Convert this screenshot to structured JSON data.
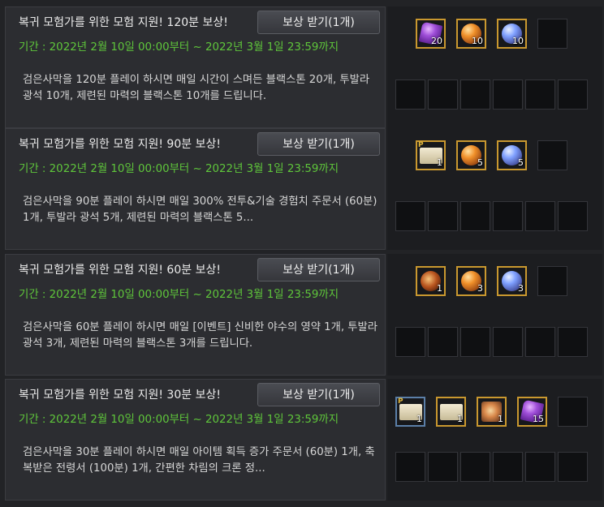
{
  "claim_label": "보상 받기(1개)",
  "cards": [
    {
      "title": "복귀 모험가를 위한 모험 지원! 120분 보상!",
      "period": "기간 : 2022년 2월 10일 00:00부터 ~ 2022년 3월 1일 23:59까지",
      "description": "검은사막을 120분 플레이 하시면 매일 시간이 스며든 블랙스톤 20개, 투발라 광석 10개, 제련된 마력의 블랙스톤 10개를 드립니다.",
      "items": [
        {
          "icon": "purple-crystal-icon",
          "count": "20"
        },
        {
          "icon": "orange-ore-icon",
          "count": "10"
        },
        {
          "icon": "blue-stone-icon",
          "count": "10"
        }
      ]
    },
    {
      "title": "복귀 모험가를 위한 모험 지원! 90분 보상!",
      "period": "기간 : 2022년 2월 10일 00:00부터 ~ 2022년 3월 1일 23:59까지",
      "description": "검은사막을 90분 플레이 하시면 매일 300% 전투&기술 경험치 주문서 (60분) 1개, 투발라 광석 5개, 제련된 마력의 블랙스톤 5...",
      "items": [
        {
          "icon": "scroll-icon",
          "count": "1",
          "p": "P"
        },
        {
          "icon": "orange-ore-icon",
          "count": "5"
        },
        {
          "icon": "blue-stone-icon",
          "count": "5"
        }
      ]
    },
    {
      "title": "복귀 모험가를 위한 모험 지원! 60분 보상!",
      "period": "기간 : 2022년 2월 10일 00:00부터 ~ 2022년 3월 1일 23:59까지",
      "description": "검은사막을 60분 플레이 하시면 매일 [이벤트] 신비한 야수의 영약 1개, 투발라 광석 3개, 제련된 마력의 블랙스톤 3개를 드립니다.",
      "items": [
        {
          "icon": "potion-icon",
          "count": "1"
        },
        {
          "icon": "orange-ore-icon",
          "count": "3"
        },
        {
          "icon": "blue-stone-icon",
          "count": "3"
        }
      ]
    },
    {
      "title": "복귀 모험가를 위한 모험 지원! 30분 보상!",
      "period": "기간 : 2022년 2월 10일 00:00부터 ~ 2022년 3월 1일 23:59까지",
      "description": "검은사막을 30분 플레이 하시면 매일 아이템 획득 증가 주문서 (60분) 1개, 축복받은 전령서 (100분) 1개, 간편한 차림의 크론 정...",
      "items": [
        {
          "icon": "blue-scroll-icon",
          "count": "1",
          "p": "P"
        },
        {
          "icon": "scroll-icon",
          "count": "1"
        },
        {
          "icon": "food-icon",
          "count": "1"
        },
        {
          "icon": "purple-crystal-icon",
          "count": "15"
        }
      ]
    }
  ]
}
